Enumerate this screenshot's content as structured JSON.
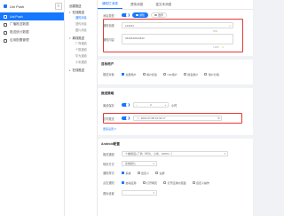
{
  "sidebar": {
    "app_name": "Uni Push",
    "items": [
      {
        "label": "Uni Push",
        "active": true
      },
      {
        "label": "广播推送数据",
        "active": false
      },
      {
        "label": "推送统计数据",
        "active": false
      },
      {
        "label": "应用配置管理",
        "active": false
      }
    ]
  },
  "nav2": {
    "title": "创建推送",
    "groups": [
      {
        "label": "在线推送",
        "links": [
          "通知消息",
          "透传消息",
          "图片消息"
        ]
      },
      {
        "label": "离线推送",
        "links": [
          "厂商通道",
          "个推通道",
          "华为通道",
          "小米通道"
        ]
      },
      {
        "label": "在线推送",
        "links": []
      }
    ]
  },
  "tabs": [
    "通知栏消息",
    "透传消息",
    "富文本消息"
  ],
  "form": {
    "message_type_label": "消息类型",
    "message_type_options": [
      "通知",
      "透传"
    ],
    "title_label": "通知标题",
    "title_value": "123212",
    "title_counter": "6/50",
    "content_label": "通知内容",
    "content_value": "3434343434343",
    "content_counter": "13/50",
    "section_target": "目标用户",
    "target_label": "推送对象",
    "target_options": [
      "全部用户",
      "用户标签",
      "CID用户",
      "别名用户",
      "用户分组"
    ],
    "section_strategy": "推送策略",
    "offline_label": "离线保存",
    "offline_value": "2",
    "offline_unit": "小时",
    "timed_label": "定时推送",
    "timed_value": "2021-07-08 16:34:17",
    "more_link": "更多设置",
    "section_android": "Android配置",
    "channel_label": "推送通道",
    "channel_value": "个推通道+厂商（华为、小米、OPPO...）",
    "sound_label": "响铃方式",
    "sound_value": "系统默认",
    "style_label": "通知样式",
    "style_options": [
      "系统",
      "自定义",
      "全屏"
    ],
    "click_label": "点击通知",
    "click_options": [
      "启动应用",
      "打开网页",
      "打开应用内页面",
      "自定义操作"
    ],
    "badge_label": "角标设置"
  },
  "colors": {
    "primary": "#1677ff",
    "highlight": "#e53935",
    "bg": "#f0f2f5"
  }
}
